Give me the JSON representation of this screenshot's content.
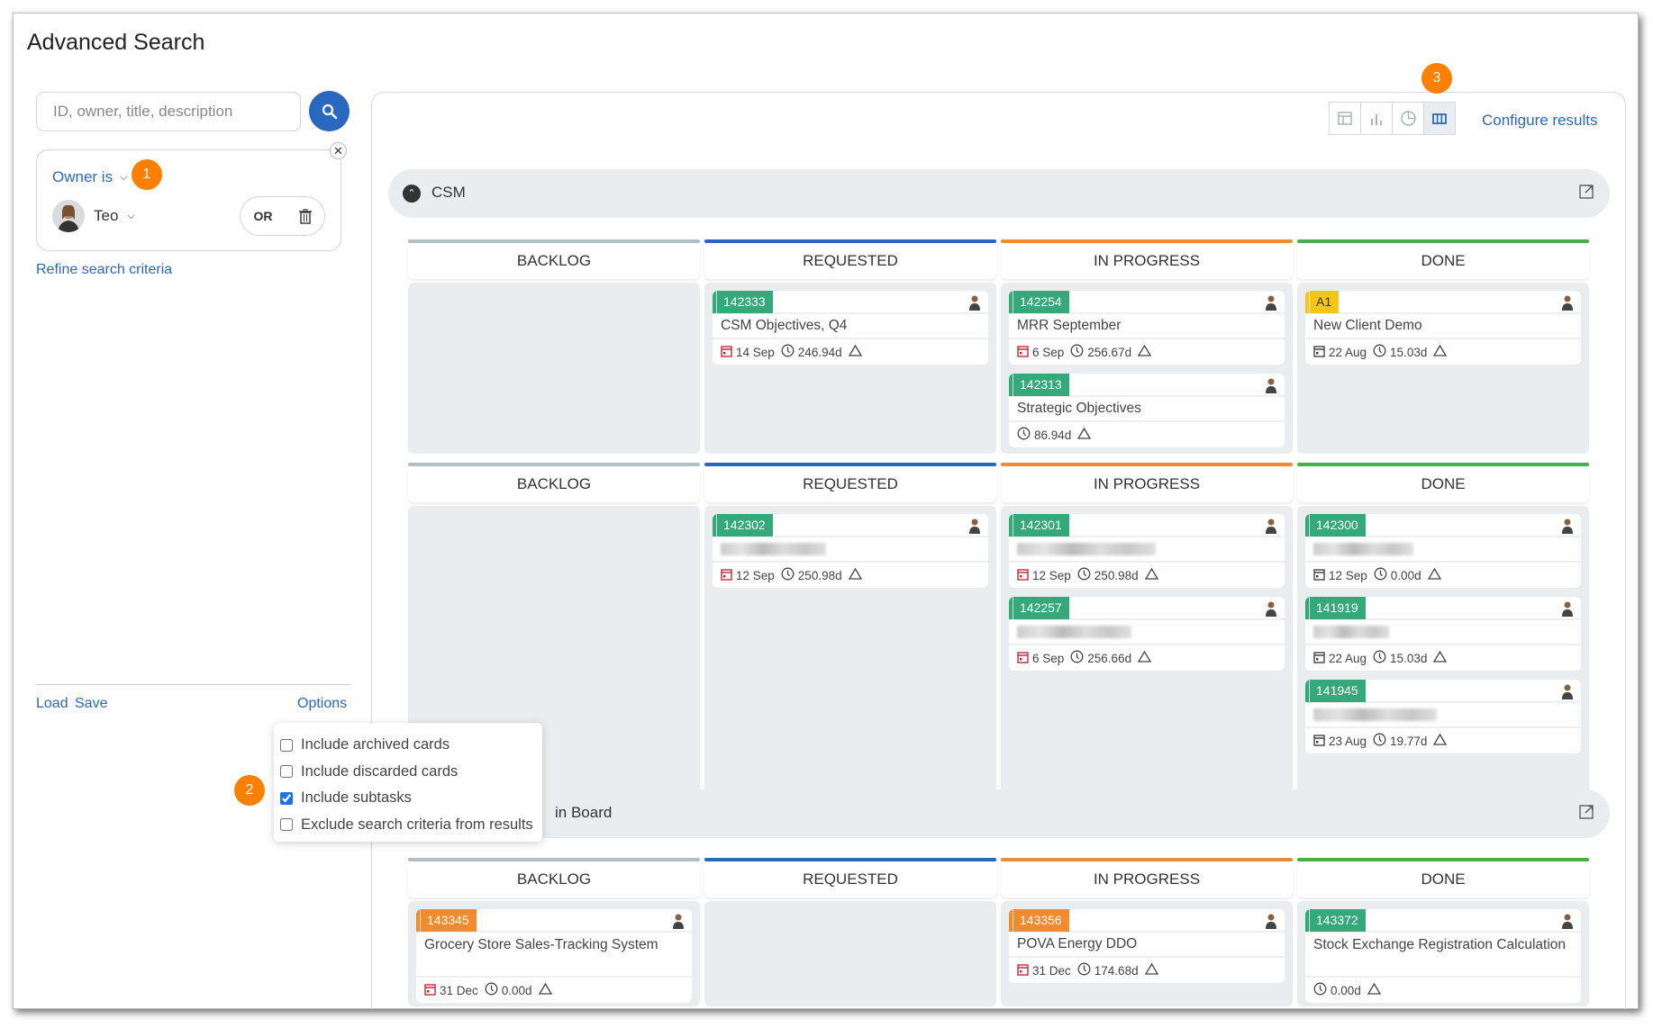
{
  "title": "Advanced Search",
  "search": {
    "placeholder": "ID, owner, title, description",
    "icon": "search-icon"
  },
  "criteria": {
    "field_label": "Owner is",
    "value": "Teo",
    "or_label": "OR",
    "badge": "1"
  },
  "refine_label": "Refine search criteria",
  "footer": {
    "load": "Load",
    "save": "Save",
    "options": "Options"
  },
  "options": {
    "badge": "2",
    "items": [
      {
        "label": "Include archived cards",
        "checked": false
      },
      {
        "label": "Include discarded cards",
        "checked": false
      },
      {
        "label": "Include subtasks",
        "checked": true
      },
      {
        "label": "Exclude search criteria from results",
        "checked": false
      }
    ]
  },
  "toolbar": {
    "badge": "3",
    "views": [
      "table-view-icon",
      "bar-chart-icon",
      "pie-chart-icon",
      "board-view-icon"
    ],
    "active_view": "board-view-icon",
    "configure": "Configure results"
  },
  "colors": {
    "accent": "#2a68c0",
    "badge": "#ff8000",
    "backlog": "#b0bec5",
    "requested": "#2a68c0",
    "in_progress": "#f28a30",
    "done": "#45b04a",
    "id_green": "#35a97a",
    "id_orange": "#f28a30",
    "id_yellow": "#f5c518"
  },
  "columns": [
    "BACKLOG",
    "REQUESTED",
    "IN PROGRESS",
    "DONE"
  ],
  "groups": [
    {
      "title": "CSM",
      "lanes": [
        [
          [],
          [
            {
              "id": "142333",
              "color": "green",
              "title": "CSM Objectives, Q4",
              "date": "14 Sep",
              "overdue": true,
              "duration": "246.94d"
            }
          ],
          [
            {
              "id": "142254",
              "color": "green",
              "title": "MRR September",
              "date": "6 Sep",
              "overdue": true,
              "duration": "256.67d"
            },
            {
              "id": "142313",
              "color": "green",
              "title": "Strategic Objectives",
              "duration": "86.94d"
            }
          ],
          [
            {
              "id": "A1",
              "color": "yellow",
              "title": "New Client Demo",
              "date": "22 Aug",
              "duration": "15.03d"
            }
          ]
        ],
        [
          [],
          [
            {
              "id": "142302",
              "color": "green",
              "blurred": true,
              "date": "12 Sep",
              "overdue": true,
              "duration": "250.98d"
            }
          ],
          [
            {
              "id": "142301",
              "color": "green",
              "blurred": true,
              "date": "12 Sep",
              "overdue": true,
              "duration": "250.98d"
            },
            {
              "id": "142257",
              "color": "green",
              "blurred": true,
              "date": "6 Sep",
              "overdue": true,
              "duration": "256.66d"
            }
          ],
          [
            {
              "id": "142300",
              "color": "green",
              "blurred": true,
              "date": "12 Sep",
              "duration": "0.00d"
            },
            {
              "id": "141919",
              "color": "green",
              "blurred": true,
              "date": "22 Aug",
              "duration": "15.03d"
            },
            {
              "id": "141945",
              "color": "green",
              "blurred": true,
              "date": "23 Aug",
              "duration": "19.77d"
            }
          ]
        ]
      ]
    },
    {
      "title": "in Board",
      "lanes": [
        [
          [
            {
              "id": "143345",
              "color": "orange",
              "title": "Grocery Store Sales-Tracking System",
              "date": "31 Dec",
              "overdue": true,
              "duration": "0.00d"
            }
          ],
          [],
          [
            {
              "id": "143356",
              "color": "orange",
              "title": "POVA Energy DDO",
              "date": "31 Dec",
              "overdue": true,
              "duration": "174.68d"
            }
          ],
          [
            {
              "id": "143372",
              "color": "green",
              "title": "Stock Exchange Registration Calculation",
              "duration": "0.00d"
            }
          ]
        ]
      ]
    }
  ]
}
